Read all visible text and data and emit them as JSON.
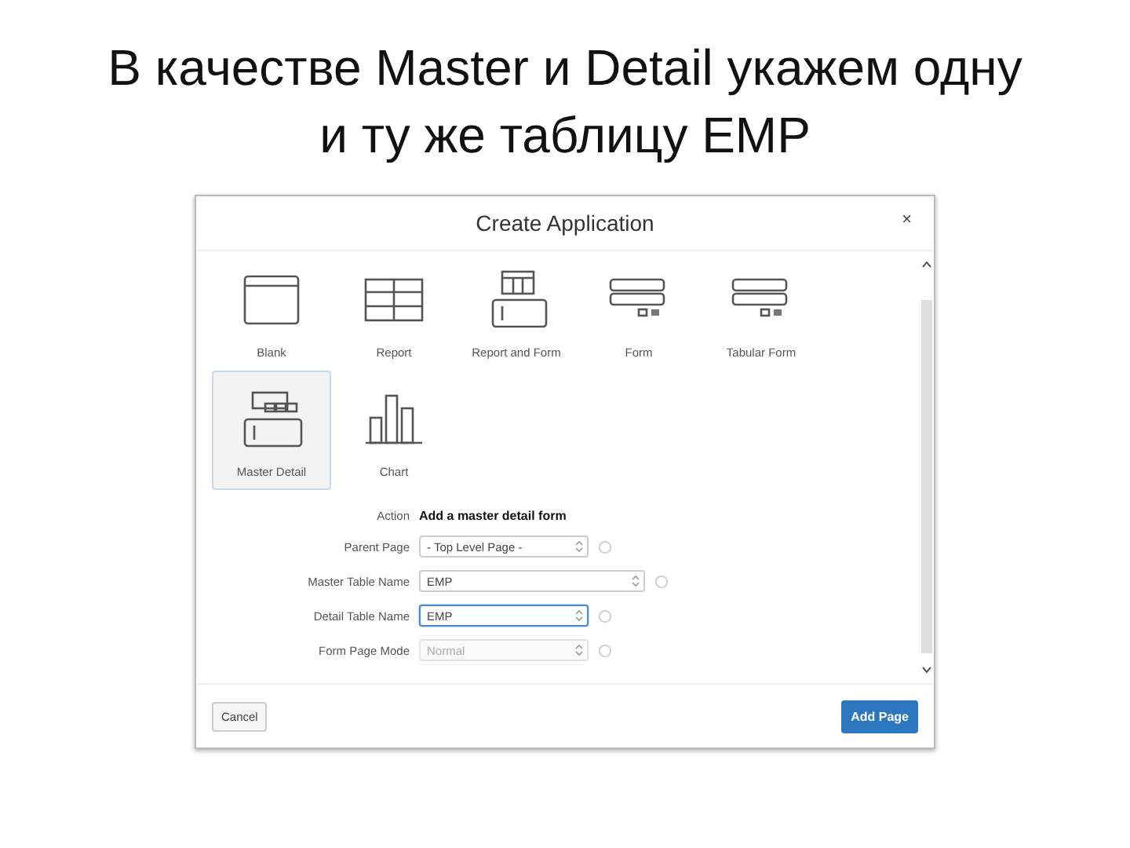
{
  "slide": {
    "title": "В качестве Master и Detail укажем одну и ту же таблицу EMP"
  },
  "dialog": {
    "title": "Create Application",
    "close": "×",
    "page_types": [
      {
        "label": "Blank",
        "kind": "blank",
        "selected": false
      },
      {
        "label": "Report",
        "kind": "report",
        "selected": false
      },
      {
        "label": "Report and Form",
        "kind": "report-form",
        "selected": false
      },
      {
        "label": "Form",
        "kind": "form",
        "selected": false
      },
      {
        "label": "Tabular Form",
        "kind": "tabular-form",
        "selected": false
      },
      {
        "label": "Master Detail",
        "kind": "master-detail",
        "selected": true
      },
      {
        "label": "Chart",
        "kind": "chart",
        "selected": false
      }
    ],
    "action": {
      "label": "Action",
      "value": "Add a master detail form"
    },
    "fields": [
      {
        "label": "Parent Page",
        "value": "- Top Level Page -",
        "wide": false,
        "focused": false,
        "disabled": false
      },
      {
        "label": "Master Table Name",
        "value": "EMP",
        "wide": true,
        "focused": false,
        "disabled": false
      },
      {
        "label": "Detail Table Name",
        "value": "EMP",
        "wide": false,
        "focused": true,
        "disabled": false
      },
      {
        "label": "Form Page Mode",
        "value": "Normal",
        "wide": false,
        "focused": false,
        "disabled": true
      }
    ],
    "buttons": {
      "cancel": "Cancel",
      "primary": "Add Page"
    }
  }
}
